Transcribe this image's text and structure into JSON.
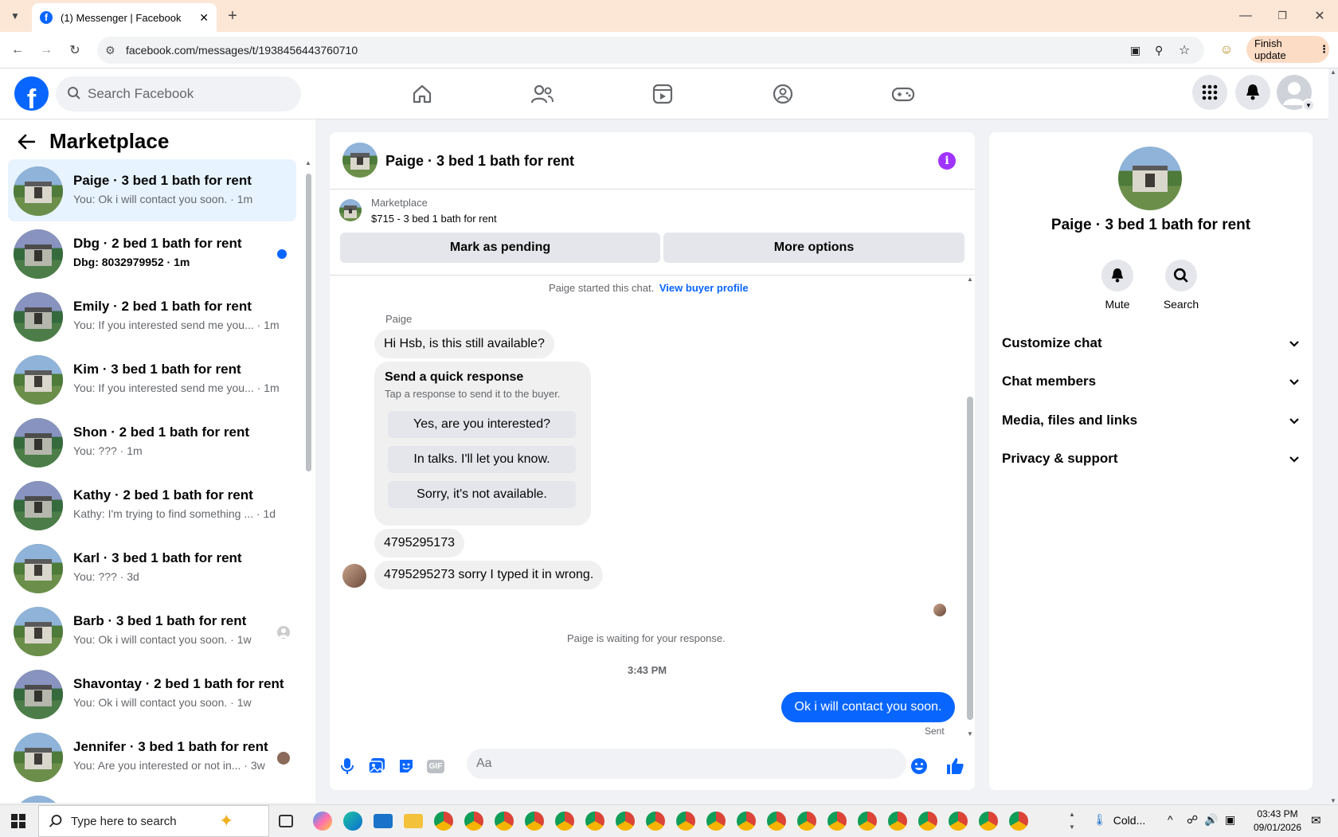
{
  "browser": {
    "tab_title": "(1) Messenger | Facebook",
    "url": "facebook.com/messages/t/1938456443760710",
    "finish_update": "Finish update"
  },
  "fb_header": {
    "search_placeholder": "Search Facebook",
    "logo_letter": "f"
  },
  "left_panel": {
    "title": "Marketplace",
    "conversations": [
      {
        "name": "Paige · 3 bed 1 bath for rent",
        "preview": "You: Ok i will contact you soon. · 1m",
        "active": true
      },
      {
        "name": "Dbg · 2 bed 1 bath for rent",
        "preview": "Dbg: 8032979952 · 1m",
        "unread": true
      },
      {
        "name": "Emily · 2 bed 1 bath for rent",
        "preview": "You: If you interested send me you... · 1m"
      },
      {
        "name": "Kim · 3 bed 1 bath for rent",
        "preview": "You: If you interested send me you... · 1m"
      },
      {
        "name": "Shon · 2 bed 1 bath for rent",
        "preview": "You: ??? · 1m"
      },
      {
        "name": "Kathy · 2 bed 1 bath for rent",
        "preview": "Kathy: I'm trying to find something ... · 1d"
      },
      {
        "name": "Karl · 3 bed 1 bath for rent",
        "preview": "You: ??? · 3d"
      },
      {
        "name": "Barb · 3 bed 1 bath for rent",
        "preview": "You: Ok i will contact you soon. · 1w"
      },
      {
        "name": "Shavontay · 2 bed 1 bath for rent",
        "preview": "You: Ok i will contact you soon. · 1w"
      },
      {
        "name": "Jennifer · 3 bed 1 bath for rent",
        "preview": "You: Are you interested or not in... · 3w"
      }
    ]
  },
  "chat": {
    "header_name": "Paige · 3 bed 1 bath for rent",
    "marketplace_label": "Marketplace",
    "listing": "$715 - 3 bed 1 bath for rent",
    "mark_pending": "Mark as pending",
    "more_options": "More options",
    "started_text": "Paige started this chat.",
    "view_buyer": "View buyer profile",
    "sender_label": "Paige",
    "msg1": "Hi Hsb, is this still available?",
    "quick_title": "Send a quick response",
    "quick_sub": "Tap a response to send it to the buyer.",
    "quick_options": [
      "Yes, are you interested?",
      "In talks. I'll let you know.",
      "Sorry, it's not available."
    ],
    "msg2": "4795295173",
    "msg3": "4795295273 sorry I typed it in wrong.",
    "waiting": "Paige is waiting for your response.",
    "time": "3:43 PM",
    "sent_msg": "Ok i will contact you soon.",
    "sent_status": "Sent",
    "input_placeholder": "Aa"
  },
  "right_panel": {
    "name": "Paige · 3 bed 1 bath for rent",
    "mute": "Mute",
    "search": "Search",
    "sections": [
      "Customize chat",
      "Chat members",
      "Media, files and links",
      "Privacy & support"
    ]
  },
  "taskbar": {
    "search_placeholder": "Type here to search",
    "weather": "Cold...",
    "time": "03:43 PM",
    "date": "09/01/2026"
  },
  "colors": {
    "brand": "#0866ff",
    "info": "#a033ff",
    "tab_bg": "#fce6d5"
  }
}
